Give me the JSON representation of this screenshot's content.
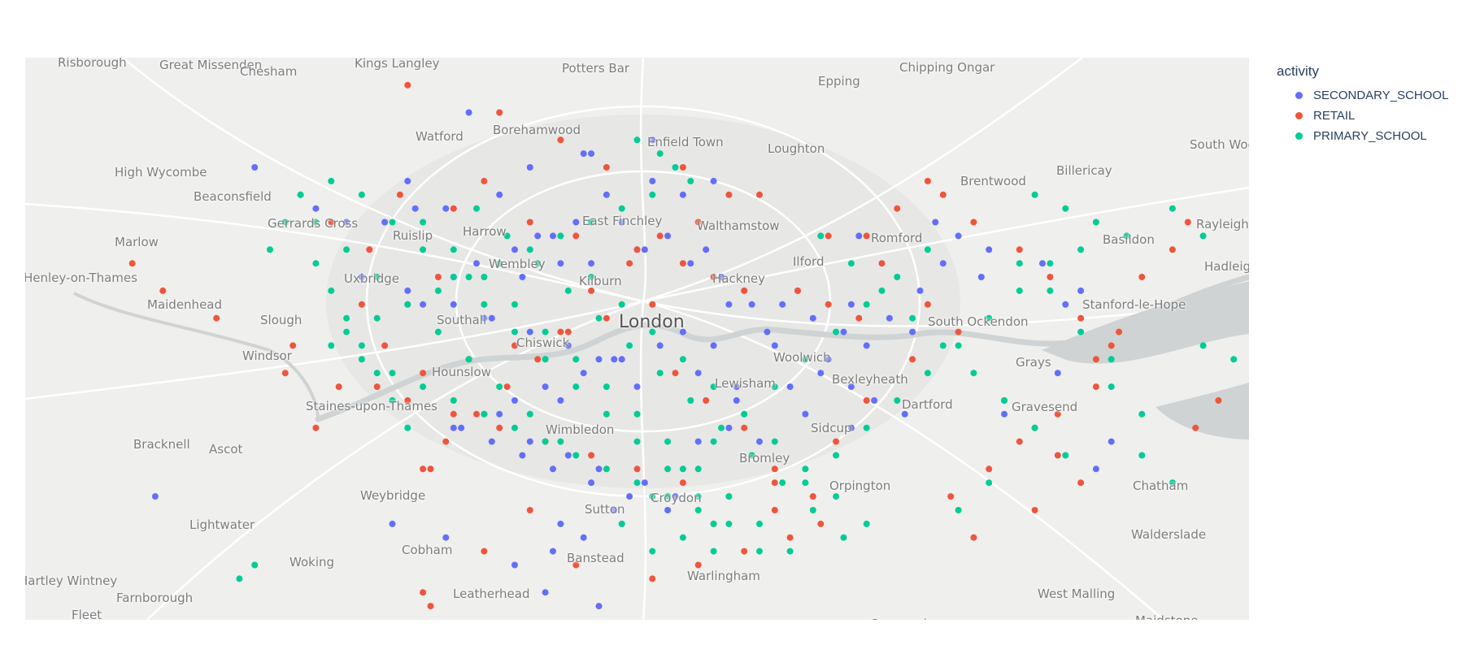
{
  "legend": {
    "title": "activity",
    "items": [
      {
        "label": "SECONDARY_SCHOOL",
        "color": "#636efa"
      },
      {
        "label": "RETAIL",
        "color": "#ef553b"
      },
      {
        "label": "PRIMARY_SCHOOL",
        "color": "#00cc96"
      }
    ]
  },
  "map": {
    "center_label": "London",
    "place_labels": [
      "Risborough",
      "Great Missenden",
      "Chesham",
      "Kings Langley",
      "Potters Bar",
      "Chipping Ongar",
      "Epping",
      "Watford",
      "Borehamwood",
      "Enfield Town",
      "Loughton",
      "High Wycombe",
      "Brentwood",
      "Billericay",
      "South Woodham Ferrers",
      "Beaconsfield",
      "Gerrards Cross",
      "Ruislip",
      "Harrow",
      "East Finchley",
      "Walthamstow",
      "Romford",
      "Rayleigh",
      "Basildon",
      "Marlow",
      "Wembley",
      "Ilford",
      "Uxbridge",
      "Kilburn",
      "Hackney",
      "Hadleigh",
      "Henley-on-Thames",
      "Maidenhead",
      "Southall",
      "Stanford-le-Hope",
      "Slough",
      "South Ockendon",
      "Chiswick",
      "Windsor",
      "Woolwich",
      "Grays",
      "Hounslow",
      "Lewisham",
      "Bexleyheath",
      "Dartford",
      "Staines-upon-Thames",
      "Gravesend",
      "Wimbledon",
      "Sidcup",
      "Bracknell",
      "Ascot",
      "Bromley",
      "Orpington",
      "Chatham",
      "Weybridge",
      "Croydon",
      "Sutton",
      "Lightwater",
      "Walderslade",
      "Cobham",
      "Banstead",
      "Woking",
      "Warlingham",
      "Hartley Wintney",
      "Leatherhead",
      "West Malling",
      "Farnborough",
      "Fleet",
      "Maidstone",
      "Sevenoaks"
    ]
  },
  "chart_data": {
    "type": "scatter",
    "legend_title": "activity",
    "legend_position": "right",
    "series": [
      {
        "name": "SECONDARY_SCHOOL",
        "color": "#636efa",
        "lat": [
          51.62,
          51.59,
          51.58,
          51.66,
          51.61,
          51.59,
          51.62,
          51.63,
          51.64,
          51.61,
          51.57,
          51.56,
          51.55,
          51.6,
          51.59,
          51.58,
          51.54,
          51.53,
          51.52,
          51.51,
          51.55,
          51.54,
          51.57,
          51.58,
          51.56,
          51.52,
          51.5,
          51.49,
          51.47,
          51.46,
          51.48,
          51.45,
          51.44,
          51.43,
          51.42,
          51.41,
          51.4,
          51.39,
          51.38,
          51.37,
          51.36,
          51.47,
          51.46,
          51.44,
          51.43,
          51.42,
          51.53,
          51.52,
          51.51,
          51.5,
          51.49,
          51.58,
          51.57,
          51.56,
          51.54,
          51.55,
          51.53,
          51.52,
          51.5,
          51.49,
          51.48,
          51.47,
          51.46,
          51.45,
          51.44,
          51.43,
          51.42,
          51.41,
          51.4,
          51.39,
          51.38,
          51.37,
          51.36,
          51.35,
          51.34,
          51.6,
          51.58,
          51.57,
          51.56,
          51.55,
          51.54,
          51.52,
          51.51,
          51.5,
          51.49,
          51.48,
          51.45,
          51.46,
          51.61,
          51.6,
          51.63,
          51.57,
          51.55,
          51.53,
          51.52,
          51.47,
          51.44,
          51.42,
          51.4,
          51.38,
          51.36,
          51.35,
          51.33,
          51.31,
          51.3,
          51.56,
          51.55,
          51.54,
          51.53,
          51.52,
          51.51,
          51.5,
          51.49,
          51.48,
          51.46,
          51.45,
          51.44,
          51.43,
          51.42
        ],
        "lon": [
          -0.5,
          -0.42,
          -0.38,
          -0.22,
          -0.3,
          -0.29,
          -0.14,
          -0.06,
          0.02,
          0.1,
          0.04,
          0.0,
          -0.06,
          -0.18,
          -0.25,
          -0.33,
          -0.36,
          -0.3,
          -0.28,
          -0.2,
          -0.1,
          -0.15,
          -0.13,
          -0.02,
          0.09,
          0.15,
          0.17,
          0.1,
          0.08,
          0.0,
          -0.05,
          -0.1,
          -0.18,
          -0.24,
          -0.14,
          -0.09,
          -0.05,
          0.01,
          0.05,
          -0.03,
          -0.1,
          0.24,
          0.2,
          0.22,
          0.28,
          0.16,
          0.21,
          0.28,
          0.33,
          0.36,
          0.3,
          0.39,
          0.42,
          0.46,
          0.45,
          0.4,
          0.37,
          0.12,
          0.06,
          0.03,
          -0.02,
          -0.07,
          -0.12,
          -0.16,
          -0.2,
          -0.23,
          -0.19,
          -0.15,
          -0.11,
          -0.06,
          -0.01,
          0.04,
          -0.02,
          -0.07,
          -0.11,
          -0.04,
          -0.08,
          -0.11,
          -0.16,
          -0.21,
          -0.24,
          -0.24,
          -0.19,
          -0.14,
          -0.09,
          -0.03,
          0.13,
          0.13,
          0.02,
          0.06,
          -0.07,
          0.29,
          0.53,
          0.58,
          0.56,
          0.55,
          0.48,
          0.62,
          0.6,
          -0.63,
          -0.32,
          -0.25,
          -0.16,
          -0.12,
          -0.05,
          0.01,
          0.07,
          0.11,
          0.14,
          0.19,
          0.23,
          0.27,
          0.18,
          0.25,
          0.28,
          0.31,
          0.35,
          0.12,
          0.08
        ]
      },
      {
        "name": "RETAIL",
        "color": "#ef553b",
        "lat": [
          51.68,
          51.66,
          51.64,
          51.62,
          51.61,
          51.6,
          51.59,
          51.58,
          51.57,
          51.56,
          51.55,
          51.54,
          51.53,
          51.52,
          51.51,
          51.5,
          51.49,
          51.48,
          51.47,
          51.46,
          51.45,
          51.44,
          51.43,
          51.42,
          51.41,
          51.4,
          51.39,
          51.38,
          51.37,
          51.36,
          51.35,
          51.34,
          51.33,
          51.32,
          51.62,
          51.6,
          51.57,
          51.55,
          51.52,
          51.5,
          51.48,
          51.45,
          51.42,
          51.39,
          51.36,
          51.33,
          51.58,
          51.56,
          51.54,
          51.52,
          51.49,
          51.46,
          51.43,
          51.4,
          51.37,
          51.34,
          51.31,
          51.55,
          51.53,
          51.51,
          51.49,
          51.47,
          51.45,
          51.43,
          51.41,
          51.39,
          51.37,
          51.35,
          51.6,
          51.58,
          51.56,
          51.54,
          51.51,
          51.49,
          51.46,
          51.44,
          51.42,
          51.4,
          51.38,
          51.6,
          51.58,
          51.57,
          51.55,
          51.53,
          51.5,
          51.48,
          51.46,
          51.44,
          51.42,
          51.4,
          51.53,
          51.52,
          51.51,
          51.47,
          51.45,
          51.43,
          51.4,
          51.38,
          51.58,
          51.56,
          51.54,
          51.5,
          51.48,
          51.3,
          51.28,
          51.27,
          51.57,
          51.55,
          51.52,
          51.49,
          51.47,
          51.45,
          51.43,
          51.61,
          51.59,
          51.57
        ],
        "lon": [
          -0.3,
          -0.18,
          -0.1,
          -0.04,
          -0.2,
          -0.31,
          -0.24,
          -0.14,
          -0.08,
          0.0,
          0.06,
          0.1,
          0.14,
          0.02,
          -0.04,
          -0.1,
          -0.16,
          -0.22,
          -0.28,
          -0.34,
          -0.3,
          -0.24,
          -0.18,
          -0.12,
          -0.06,
          0.0,
          0.06,
          0.12,
          0.18,
          0.24,
          0.2,
          0.14,
          0.08,
          0.02,
          0.06,
          0.16,
          0.25,
          0.32,
          0.38,
          0.42,
          0.36,
          0.3,
          0.26,
          0.18,
          0.1,
          -0.08,
          -0.4,
          -0.35,
          -0.26,
          -0.36,
          -0.33,
          -0.39,
          -0.42,
          -0.27,
          -0.14,
          -0.2,
          -0.28,
          -0.66,
          -0.62,
          -0.55,
          -0.45,
          -0.46,
          0.48,
          0.52,
          0.55,
          0.58,
          0.52,
          0.44,
          0.4,
          0.44,
          0.5,
          0.54,
          0.58,
          0.62,
          0.6,
          0.55,
          0.5,
          0.46,
          0.41,
          0.12,
          0.08,
          0.03,
          -0.01,
          -0.06,
          -0.09,
          -0.13,
          -0.17,
          -0.21,
          -0.25,
          -0.28,
          0.21,
          0.25,
          0.29,
          0.05,
          0.09,
          0.14,
          0.18,
          0.23,
          0.72,
          0.7,
          0.66,
          0.63,
          0.6,
          -0.27,
          -0.33,
          0.28,
          0.8,
          0.84,
          0.88,
          0.86,
          0.82,
          0.76,
          0.73,
          0.38,
          0.34,
          0.3
        ]
      },
      {
        "name": "PRIMARY_SCHOOL",
        "color": "#00cc96",
        "lat": [
          51.64,
          51.63,
          51.62,
          51.61,
          51.6,
          51.59,
          51.58,
          51.57,
          51.56,
          51.55,
          51.54,
          51.53,
          51.52,
          51.51,
          51.5,
          51.49,
          51.48,
          51.47,
          51.46,
          51.45,
          51.44,
          51.43,
          51.42,
          51.41,
          51.4,
          51.39,
          51.38,
          51.37,
          51.36,
          51.35,
          51.34,
          51.6,
          51.58,
          51.56,
          51.54,
          51.52,
          51.5,
          51.48,
          51.46,
          51.44,
          51.42,
          51.4,
          51.38,
          51.36,
          51.34,
          51.59,
          51.57,
          51.55,
          51.53,
          51.51,
          51.49,
          51.47,
          51.45,
          51.43,
          51.41,
          51.39,
          51.37,
          51.35,
          51.58,
          51.56,
          51.54,
          51.52,
          51.5,
          51.48,
          51.46,
          51.44,
          51.42,
          51.4,
          51.38,
          51.36,
          51.34,
          51.57,
          51.55,
          51.53,
          51.51,
          51.49,
          51.47,
          51.45,
          51.43,
          51.41,
          51.39,
          51.37,
          51.56,
          51.54,
          51.52,
          51.5,
          51.48,
          51.46,
          51.44,
          51.42,
          51.4,
          51.38,
          51.36,
          51.6,
          51.59,
          51.58,
          51.57,
          51.56,
          51.55,
          51.53,
          51.51,
          51.49,
          51.47,
          51.45,
          51.43,
          51.41,
          51.39,
          51.61,
          51.6,
          51.58,
          51.56,
          51.54,
          51.52,
          51.5,
          51.48,
          51.46,
          51.44,
          51.42,
          51.54,
          51.52,
          51.5,
          51.48,
          51.46,
          51.44,
          51.42,
          51.4,
          51.38,
          51.36,
          51.34,
          51.32,
          51.33,
          51.56,
          51.58,
          51.6,
          51.55,
          51.53,
          51.51,
          51.49,
          51.47,
          51.45,
          51.43,
          51.41,
          51.39,
          51.49,
          51.48,
          51.46,
          51.44,
          51.59,
          51.57,
          51.55,
          51.53,
          51.5,
          51.48,
          51.46,
          51.44
        ],
        "lon": [
          0.0,
          0.03,
          0.05,
          0.07,
          0.02,
          -0.02,
          -0.06,
          -0.1,
          -0.14,
          -0.18,
          -0.22,
          -0.26,
          -0.3,
          -0.34,
          -0.38,
          -0.4,
          -0.36,
          -0.32,
          -0.28,
          -0.24,
          -0.2,
          -0.16,
          -0.12,
          -0.08,
          -0.04,
          0.0,
          0.04,
          0.08,
          0.1,
          0.06,
          0.02,
          -0.36,
          -0.32,
          -0.28,
          -0.24,
          -0.2,
          -0.16,
          -0.12,
          -0.08,
          -0.04,
          0.0,
          0.04,
          0.08,
          0.12,
          0.16,
          -0.21,
          -0.17,
          -0.13,
          -0.09,
          -0.05,
          -0.01,
          0.03,
          0.07,
          0.11,
          0.15,
          0.19,
          0.23,
          0.27,
          -0.28,
          -0.24,
          -0.2,
          -0.16,
          -0.12,
          -0.08,
          -0.04,
          0.0,
          0.04,
          0.08,
          0.12,
          0.16,
          0.2,
          0.24,
          0.28,
          0.32,
          0.36,
          0.4,
          0.44,
          0.48,
          0.52,
          0.56,
          0.46,
          0.42,
          0.38,
          0.34,
          0.3,
          0.26,
          0.22,
          0.18,
          0.14,
          0.1,
          0.06,
          0.02,
          -0.02,
          0.52,
          0.56,
          0.6,
          0.64,
          0.58,
          0.54,
          0.5,
          0.46,
          0.42,
          0.38,
          0.34,
          0.3,
          0.26,
          0.22,
          -0.4,
          -0.44,
          -0.42,
          -0.38,
          -0.34,
          -0.3,
          -0.26,
          -0.22,
          -0.18,
          -0.14,
          -0.1,
          -0.06,
          -0.02,
          0.02,
          0.06,
          0.1,
          0.14,
          0.18,
          0.22,
          0.26,
          0.3,
          0.1,
          -0.52,
          -0.5,
          -0.48,
          -0.46,
          -0.44,
          -0.42,
          -0.4,
          -0.38,
          -0.36,
          -0.34,
          -0.32,
          -0.3,
          0.66,
          0.7,
          0.74,
          0.78,
          0.62,
          0.66,
          0.7,
          0.74,
          0.5,
          0.54,
          0.58,
          0.62
        ]
      }
    ]
  }
}
